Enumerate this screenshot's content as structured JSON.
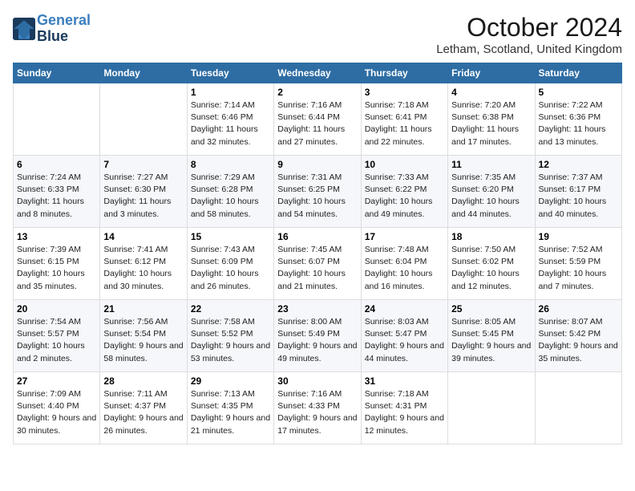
{
  "logo": {
    "line1": "General",
    "line2": "Blue"
  },
  "title": "October 2024",
  "subtitle": "Letham, Scotland, United Kingdom",
  "headers": [
    "Sunday",
    "Monday",
    "Tuesday",
    "Wednesday",
    "Thursday",
    "Friday",
    "Saturday"
  ],
  "weeks": [
    [
      {
        "day": "",
        "sunrise": "",
        "sunset": "",
        "daylight": ""
      },
      {
        "day": "",
        "sunrise": "",
        "sunset": "",
        "daylight": ""
      },
      {
        "day": "1",
        "sunrise": "Sunrise: 7:14 AM",
        "sunset": "Sunset: 6:46 PM",
        "daylight": "Daylight: 11 hours and 32 minutes."
      },
      {
        "day": "2",
        "sunrise": "Sunrise: 7:16 AM",
        "sunset": "Sunset: 6:44 PM",
        "daylight": "Daylight: 11 hours and 27 minutes."
      },
      {
        "day": "3",
        "sunrise": "Sunrise: 7:18 AM",
        "sunset": "Sunset: 6:41 PM",
        "daylight": "Daylight: 11 hours and 22 minutes."
      },
      {
        "day": "4",
        "sunrise": "Sunrise: 7:20 AM",
        "sunset": "Sunset: 6:38 PM",
        "daylight": "Daylight: 11 hours and 17 minutes."
      },
      {
        "day": "5",
        "sunrise": "Sunrise: 7:22 AM",
        "sunset": "Sunset: 6:36 PM",
        "daylight": "Daylight: 11 hours and 13 minutes."
      }
    ],
    [
      {
        "day": "6",
        "sunrise": "Sunrise: 7:24 AM",
        "sunset": "Sunset: 6:33 PM",
        "daylight": "Daylight: 11 hours and 8 minutes."
      },
      {
        "day": "7",
        "sunrise": "Sunrise: 7:27 AM",
        "sunset": "Sunset: 6:30 PM",
        "daylight": "Daylight: 11 hours and 3 minutes."
      },
      {
        "day": "8",
        "sunrise": "Sunrise: 7:29 AM",
        "sunset": "Sunset: 6:28 PM",
        "daylight": "Daylight: 10 hours and 58 minutes."
      },
      {
        "day": "9",
        "sunrise": "Sunrise: 7:31 AM",
        "sunset": "Sunset: 6:25 PM",
        "daylight": "Daylight: 10 hours and 54 minutes."
      },
      {
        "day": "10",
        "sunrise": "Sunrise: 7:33 AM",
        "sunset": "Sunset: 6:22 PM",
        "daylight": "Daylight: 10 hours and 49 minutes."
      },
      {
        "day": "11",
        "sunrise": "Sunrise: 7:35 AM",
        "sunset": "Sunset: 6:20 PM",
        "daylight": "Daylight: 10 hours and 44 minutes."
      },
      {
        "day": "12",
        "sunrise": "Sunrise: 7:37 AM",
        "sunset": "Sunset: 6:17 PM",
        "daylight": "Daylight: 10 hours and 40 minutes."
      }
    ],
    [
      {
        "day": "13",
        "sunrise": "Sunrise: 7:39 AM",
        "sunset": "Sunset: 6:15 PM",
        "daylight": "Daylight: 10 hours and 35 minutes."
      },
      {
        "day": "14",
        "sunrise": "Sunrise: 7:41 AM",
        "sunset": "Sunset: 6:12 PM",
        "daylight": "Daylight: 10 hours and 30 minutes."
      },
      {
        "day": "15",
        "sunrise": "Sunrise: 7:43 AM",
        "sunset": "Sunset: 6:09 PM",
        "daylight": "Daylight: 10 hours and 26 minutes."
      },
      {
        "day": "16",
        "sunrise": "Sunrise: 7:45 AM",
        "sunset": "Sunset: 6:07 PM",
        "daylight": "Daylight: 10 hours and 21 minutes."
      },
      {
        "day": "17",
        "sunrise": "Sunrise: 7:48 AM",
        "sunset": "Sunset: 6:04 PM",
        "daylight": "Daylight: 10 hours and 16 minutes."
      },
      {
        "day": "18",
        "sunrise": "Sunrise: 7:50 AM",
        "sunset": "Sunset: 6:02 PM",
        "daylight": "Daylight: 10 hours and 12 minutes."
      },
      {
        "day": "19",
        "sunrise": "Sunrise: 7:52 AM",
        "sunset": "Sunset: 5:59 PM",
        "daylight": "Daylight: 10 hours and 7 minutes."
      }
    ],
    [
      {
        "day": "20",
        "sunrise": "Sunrise: 7:54 AM",
        "sunset": "Sunset: 5:57 PM",
        "daylight": "Daylight: 10 hours and 2 minutes."
      },
      {
        "day": "21",
        "sunrise": "Sunrise: 7:56 AM",
        "sunset": "Sunset: 5:54 PM",
        "daylight": "Daylight: 9 hours and 58 minutes."
      },
      {
        "day": "22",
        "sunrise": "Sunrise: 7:58 AM",
        "sunset": "Sunset: 5:52 PM",
        "daylight": "Daylight: 9 hours and 53 minutes."
      },
      {
        "day": "23",
        "sunrise": "Sunrise: 8:00 AM",
        "sunset": "Sunset: 5:49 PM",
        "daylight": "Daylight: 9 hours and 49 minutes."
      },
      {
        "day": "24",
        "sunrise": "Sunrise: 8:03 AM",
        "sunset": "Sunset: 5:47 PM",
        "daylight": "Daylight: 9 hours and 44 minutes."
      },
      {
        "day": "25",
        "sunrise": "Sunrise: 8:05 AM",
        "sunset": "Sunset: 5:45 PM",
        "daylight": "Daylight: 9 hours and 39 minutes."
      },
      {
        "day": "26",
        "sunrise": "Sunrise: 8:07 AM",
        "sunset": "Sunset: 5:42 PM",
        "daylight": "Daylight: 9 hours and 35 minutes."
      }
    ],
    [
      {
        "day": "27",
        "sunrise": "Sunrise: 7:09 AM",
        "sunset": "Sunset: 4:40 PM",
        "daylight": "Daylight: 9 hours and 30 minutes."
      },
      {
        "day": "28",
        "sunrise": "Sunrise: 7:11 AM",
        "sunset": "Sunset: 4:37 PM",
        "daylight": "Daylight: 9 hours and 26 minutes."
      },
      {
        "day": "29",
        "sunrise": "Sunrise: 7:13 AM",
        "sunset": "Sunset: 4:35 PM",
        "daylight": "Daylight: 9 hours and 21 minutes."
      },
      {
        "day": "30",
        "sunrise": "Sunrise: 7:16 AM",
        "sunset": "Sunset: 4:33 PM",
        "daylight": "Daylight: 9 hours and 17 minutes."
      },
      {
        "day": "31",
        "sunrise": "Sunrise: 7:18 AM",
        "sunset": "Sunset: 4:31 PM",
        "daylight": "Daylight: 9 hours and 12 minutes."
      },
      {
        "day": "",
        "sunrise": "",
        "sunset": "",
        "daylight": ""
      },
      {
        "day": "",
        "sunrise": "",
        "sunset": "",
        "daylight": ""
      }
    ]
  ]
}
